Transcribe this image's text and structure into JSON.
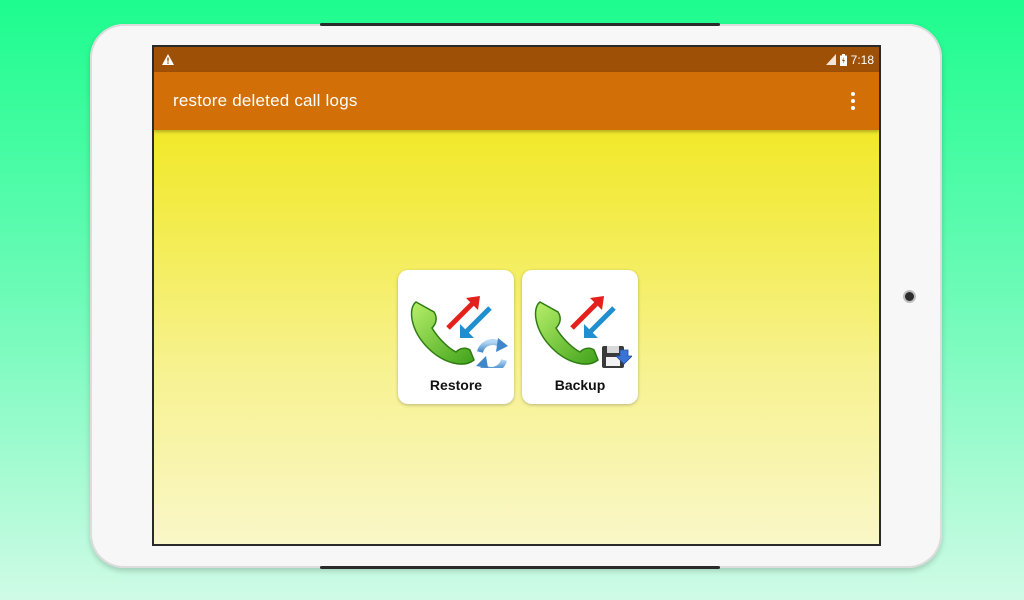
{
  "status_bar": {
    "time": "7:18",
    "warning_icon": "warning-icon",
    "signal_icon": "signal-icon",
    "battery_icon": "battery-charging-icon"
  },
  "app_bar": {
    "title": "restore deleted call logs",
    "menu_icon": "overflow-menu-icon"
  },
  "tiles": [
    {
      "label": "Restore",
      "icon": "phone-restore-icon"
    },
    {
      "label": "Backup",
      "icon": "phone-backup-icon"
    }
  ],
  "colors": {
    "status_bar": "#9e5006",
    "app_bar": "#d36f07",
    "background_top": "#f0e60a",
    "background_bottom": "#faf7c8",
    "page_background": "#1dfc8e"
  }
}
